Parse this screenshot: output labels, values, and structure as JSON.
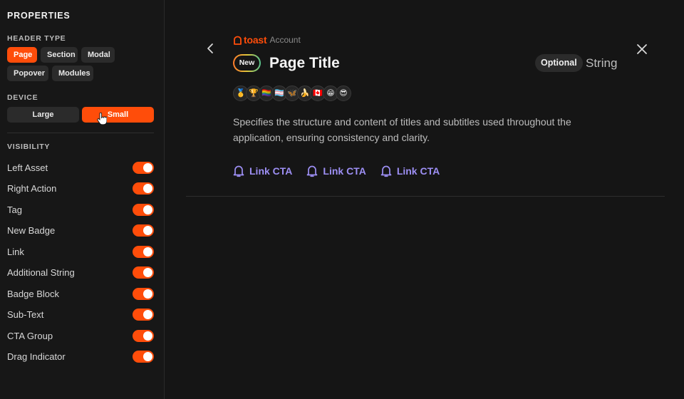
{
  "sidebar": {
    "title": "PROPERTIES",
    "header_type": {
      "label": "HEADER TYPE",
      "options": [
        "Page",
        "Section",
        "Modal",
        "Popover",
        "Modules"
      ],
      "selected": "Page"
    },
    "device": {
      "label": "DEVICE",
      "options": [
        "Large",
        "Small"
      ],
      "selected": "Small"
    },
    "visibility": {
      "label": "VISIBILITY",
      "items": [
        {
          "label": "Left Asset",
          "on": true
        },
        {
          "label": "Right Action",
          "on": true
        },
        {
          "label": "Tag",
          "on": true
        },
        {
          "label": "New Badge",
          "on": true
        },
        {
          "label": "Link",
          "on": true
        },
        {
          "label": "Additional String",
          "on": true
        },
        {
          "label": "Badge Block",
          "on": true
        },
        {
          "label": "Sub-Text",
          "on": true
        },
        {
          "label": "CTA Group",
          "on": true
        },
        {
          "label": "Drag Indicator",
          "on": true
        }
      ]
    }
  },
  "header": {
    "brand": "toast",
    "brand_sub": "Account",
    "new_badge": "New",
    "title": "Page Title",
    "tag": "Optional",
    "additional_string": "String",
    "emojis": [
      "🥇",
      "🏆",
      "🏳️‍🌈",
      "🏳️‍⚧️",
      "🦋",
      "🍌",
      "🇨🇦",
      "😁",
      "😎"
    ],
    "description": "Specifies the structure and content of titles and subtitles used throughout the application, ensuring consistency and clarity.",
    "ctas": [
      "Link CTA",
      "Link CTA",
      "Link CTA"
    ]
  },
  "colors": {
    "accent": "#ff4d0a",
    "link": "#9d8ff4",
    "background": "#151515"
  },
  "icons": {
    "back": "chevron-left-icon",
    "close": "close-icon",
    "cta": "bell-icon",
    "brand": "toast-logo-icon",
    "cursor": "hand-pointer-icon"
  }
}
